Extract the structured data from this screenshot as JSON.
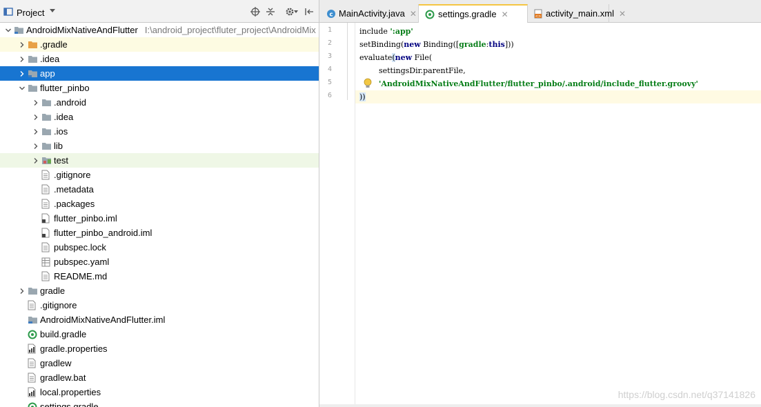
{
  "project_panel": {
    "title": "Project",
    "root_path": "I:\\android_project\\fluter_project\\AndroidMix"
  },
  "tree": {
    "rows": [
      {
        "label": "AndroidMixNativeAndFlutter",
        "type": "module",
        "expanded": true
      },
      {
        "label": ".gradle",
        "type": "folder-orange",
        "expanded": false
      },
      {
        "label": ".idea",
        "type": "folder",
        "expanded": false
      },
      {
        "label": "app",
        "type": "module",
        "expanded": false
      },
      {
        "label": "flutter_pinbo",
        "type": "folder",
        "expanded": true
      },
      {
        "label": ".android",
        "type": "folder",
        "expanded": false
      },
      {
        "label": ".idea",
        "type": "folder",
        "expanded": false
      },
      {
        "label": ".ios",
        "type": "folder",
        "expanded": false
      },
      {
        "label": "lib",
        "type": "folder",
        "expanded": false
      },
      {
        "label": "test",
        "type": "folder-test",
        "expanded": false
      },
      {
        "label": ".gitignore",
        "type": "file"
      },
      {
        "label": ".metadata",
        "type": "file"
      },
      {
        "label": ".packages",
        "type": "file"
      },
      {
        "label": "flutter_pinbo.iml",
        "type": "iml"
      },
      {
        "label": "flutter_pinbo_android.iml",
        "type": "iml"
      },
      {
        "label": "pubspec.lock",
        "type": "file"
      },
      {
        "label": "pubspec.yaml",
        "type": "yaml"
      },
      {
        "label": "README.md",
        "type": "file"
      },
      {
        "label": "gradle",
        "type": "folder",
        "expanded": false
      },
      {
        "label": ".gitignore",
        "type": "file"
      },
      {
        "label": "AndroidMixNativeAndFlutter.iml",
        "type": "module-iml"
      },
      {
        "label": "build.gradle",
        "type": "gradle"
      },
      {
        "label": "gradle.properties",
        "type": "properties"
      },
      {
        "label": "gradlew",
        "type": "file"
      },
      {
        "label": "gradlew.bat",
        "type": "file"
      },
      {
        "label": "local.properties",
        "type": "properties"
      },
      {
        "label": "settings.gradle",
        "type": "gradle"
      }
    ]
  },
  "editor": {
    "tabs": [
      {
        "label": "MainActivity.java",
        "icon": "java-class-icon",
        "active": false
      },
      {
        "label": "settings.gradle",
        "icon": "gradle-icon",
        "active": true
      },
      {
        "label": "activity_main.xml",
        "icon": "xml-icon",
        "active": false
      }
    ],
    "line_numbers": [
      "1",
      "2",
      "3",
      "4",
      "5",
      "6"
    ],
    "code": {
      "l1a": "include ",
      "l1b": "':app'",
      "l2a": "setBinding(",
      "l2b": "new",
      "l2c": " Binding([",
      "l2d": "gradle",
      "l2e": ":",
      "l2f": "this",
      "l2g": "]))",
      "l3a": "evaluate",
      "l3b": "(",
      "l3c": "new",
      "l3d": " File(",
      "l4a": "        settingsDir.parentFile,",
      "l5a": "        ",
      "l5b": "'AndroidMixNativeAndFlutter/flutter_pinbo/.android/include_flutter.groovy'",
      "l6a": "))"
    },
    "watermark": "https://blog.csdn.net/q37141826"
  },
  "colors": {
    "selection": "#1875d1",
    "string": "#067d17",
    "keyword": "#000080"
  }
}
